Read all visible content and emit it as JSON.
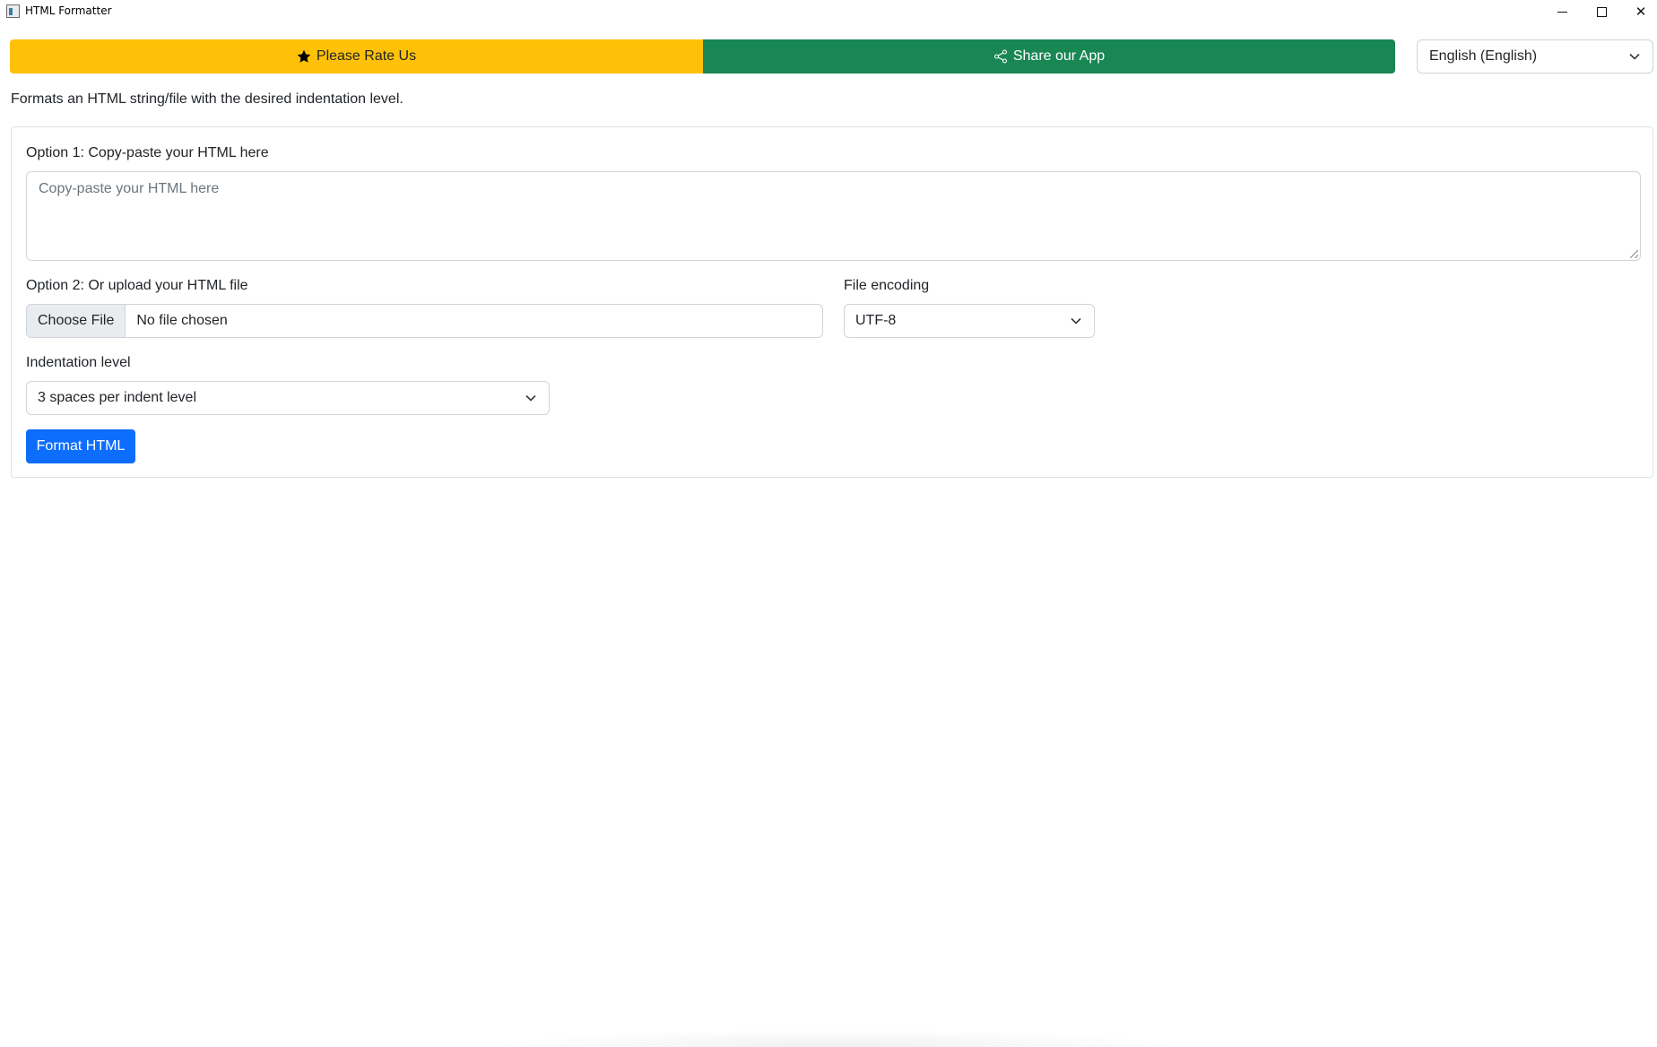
{
  "window": {
    "title": "HTML Formatter",
    "controls": {
      "minimize": "–",
      "maximize": "☐",
      "close": "✕"
    }
  },
  "toolbar": {
    "rate_label": "Please Rate Us",
    "rate_icon": "star-icon",
    "share_label": "Share our App",
    "share_icon": "share-icon",
    "language_selected": "English (English)"
  },
  "description": "Formats an HTML string/file with the desired indentation level.",
  "form": {
    "option1_label": "Option 1: Copy-paste your HTML here",
    "option1_placeholder": "Copy-paste your HTML here",
    "option2_label": "Option 2: Or upload your HTML file",
    "choose_file_label": "Choose File",
    "file_status": "No file chosen",
    "encoding_label": "File encoding",
    "encoding_selected": "UTF-8",
    "indent_label": "Indentation level",
    "indent_selected": "3 spaces per indent level",
    "submit_label": "Format HTML"
  },
  "colors": {
    "rate_bg": "#ffc107",
    "share_bg": "#198754",
    "primary": "#0d6efd",
    "border": "#ced4da"
  }
}
